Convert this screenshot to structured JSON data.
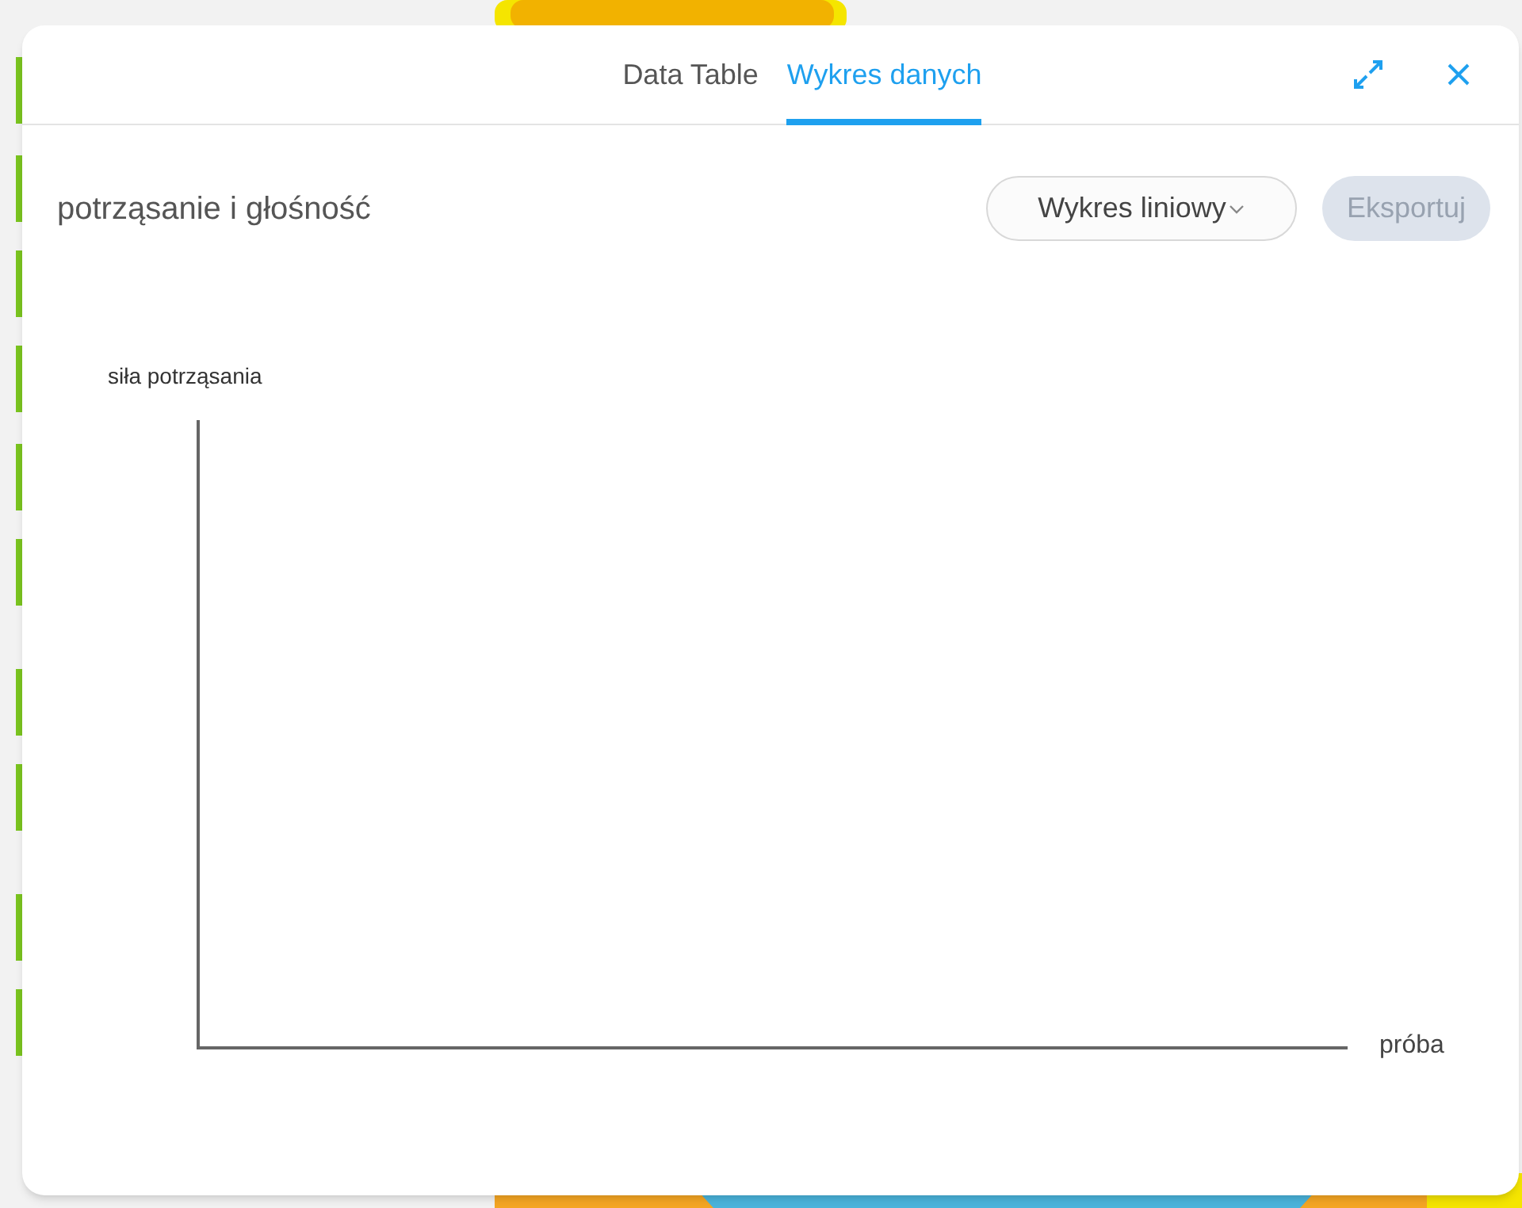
{
  "tabs": [
    {
      "label": "Data Table",
      "selected": false
    },
    {
      "label": "Wykres danych",
      "selected": true
    }
  ],
  "title": "potrząsanie i głośność",
  "chart_type_dropdown": {
    "value": "Wykres liniowy"
  },
  "export_button": {
    "label": "Eksportuj",
    "disabled": true
  },
  "chart": {
    "ylabel": "siła potrząsania",
    "xlabel": "próba"
  }
}
